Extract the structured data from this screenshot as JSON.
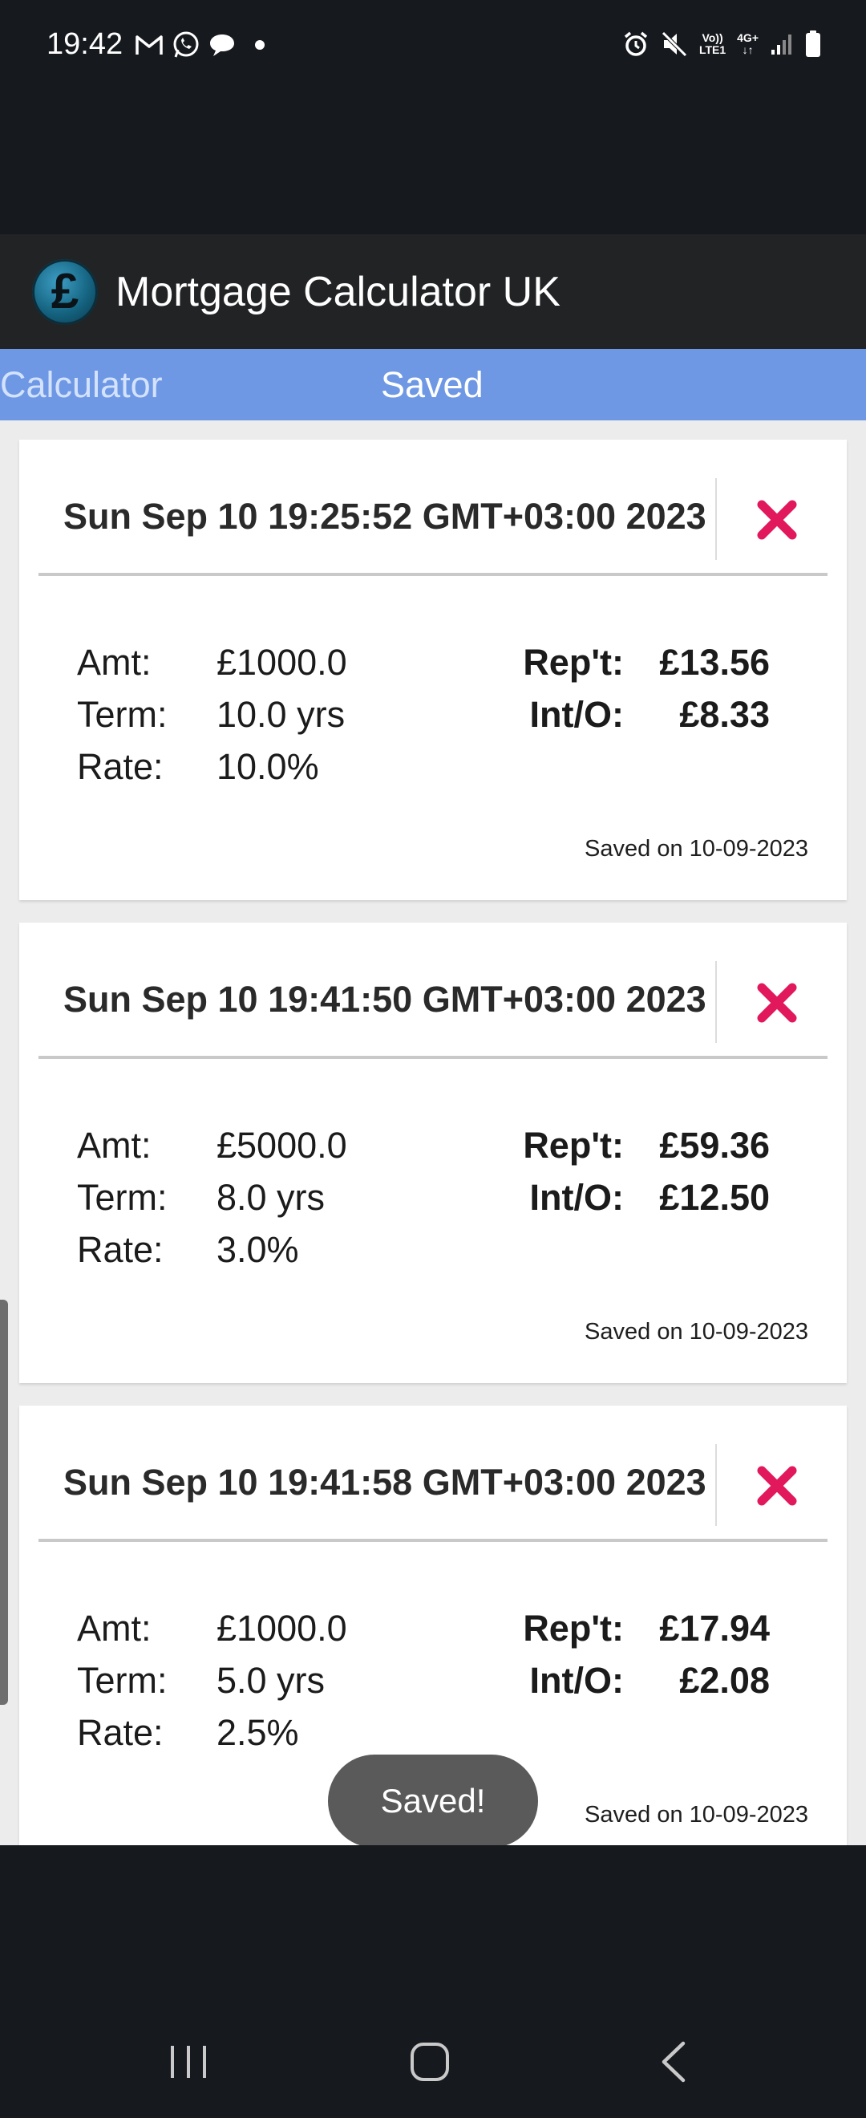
{
  "status_bar": {
    "time": "19:42",
    "left_icons": [
      "gmail-icon",
      "whatsapp-icon",
      "chat-bubble-icon",
      "dot-icon"
    ],
    "right_icons": [
      "alarm-icon",
      "mute-icon",
      "volte-icon",
      "4g-icon",
      "signal-icon",
      "battery-icon"
    ],
    "volte_top": "Vo))",
    "volte_bottom": "LTE1",
    "net_top": "4G+",
    "net_bottom": "↓↑"
  },
  "app": {
    "title": "Mortgage Calculator UK",
    "logo_symbol": "£",
    "colors": {
      "app_bar": "#222325",
      "tab_bar": "#6f98e4",
      "delete": "#e2185c"
    }
  },
  "tabs": [
    {
      "label": "Calculator",
      "active": false
    },
    {
      "label": "Saved",
      "active": true
    }
  ],
  "saved": [
    {
      "title": "Sun Sep 10 19:25:52 GMT+03:00 2023",
      "amount_label": "Amt:",
      "amount": "£1000.0",
      "term_label": "Term:",
      "term": "10.0 yrs",
      "rate_label": "Rate:",
      "rate": "10.0%",
      "repayment_label": "Rep't:",
      "repayment": "£13.56",
      "interest_only_label": "Int/O:",
      "interest_only": "£8.33",
      "saved_on": "Saved on 10-09-2023"
    },
    {
      "title": "Sun Sep 10 19:41:50 GMT+03:00 2023",
      "amount_label": "Amt:",
      "amount": "£5000.0",
      "term_label": "Term:",
      "term": "8.0 yrs",
      "rate_label": "Rate:",
      "rate": "3.0%",
      "repayment_label": "Rep't:",
      "repayment": "£59.36",
      "interest_only_label": "Int/O:",
      "interest_only": "£12.50",
      "saved_on": "Saved on 10-09-2023"
    },
    {
      "title": "Sun Sep 10 19:41:58 GMT+03:00 2023",
      "amount_label": "Amt:",
      "amount": "£1000.0",
      "term_label": "Term:",
      "term": "5.0 yrs",
      "rate_label": "Rate:",
      "rate": "2.5%",
      "repayment_label": "Rep't:",
      "repayment": "£17.94",
      "interest_only_label": "Int/O:",
      "interest_only": "£2.08",
      "saved_on": "Saved on 10-09-2023"
    }
  ],
  "toast": {
    "text": "Saved!"
  },
  "nav_bar": {
    "buttons": [
      "recents-icon",
      "home-icon",
      "back-icon"
    ]
  }
}
